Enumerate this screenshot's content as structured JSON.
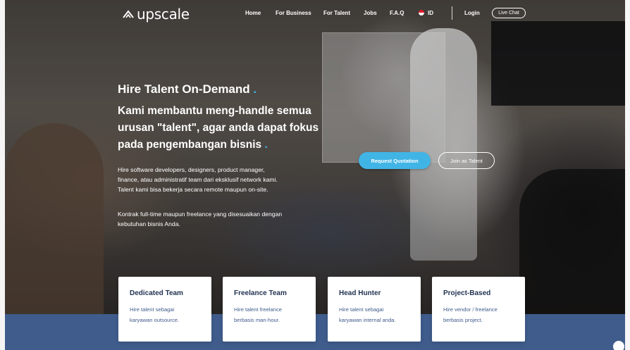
{
  "brand": {
    "name": "upscale"
  },
  "nav": {
    "items": [
      "Home",
      "For Business",
      "For Talent",
      "Jobs",
      "F.A.Q"
    ],
    "language": "ID",
    "login": "Login",
    "live_chat": "Live Chat"
  },
  "hero": {
    "title": "Hire Talent On-Demand",
    "title_dot": ".",
    "subtitle_lines": [
      "Kami membantu meng-handle semua",
      "urusan \"talent\", agar anda dapat fokus",
      "pada pengembangan bisnis"
    ],
    "subtitle_dot": ".",
    "description_lines": [
      "Hire software developers, designers, product manager,",
      "finance, atau administratif team dari eksklusif network kami.",
      "Talent kami bisa bekerja secara remote maupun on-site."
    ],
    "description2_lines": [
      "Kontrak full-time maupun freelance yang disesuaikan dengan",
      "kebutuhan bisnis Anda."
    ],
    "primary_button": "Request Quotation",
    "secondary_button": "Join as Talent"
  },
  "cards": [
    {
      "title": "Dedicated Team",
      "desc": [
        "Hire talent sebagai",
        "karyawan outsource."
      ]
    },
    {
      "title": "Freelance Team",
      "desc": [
        "Hire talent freelance",
        "berbasis man-hour."
      ]
    },
    {
      "title": "Head Hunter",
      "desc": [
        "Hire talent sebagai",
        "karyawan internal anda."
      ]
    },
    {
      "title": "Project-Based",
      "desc": [
        "Hire vendor / freelance",
        "berbasis project."
      ]
    }
  ],
  "colors": {
    "accent": "#41b4e6",
    "band": "#3f5c8c",
    "card_title": "#1f3150"
  },
  "icons": {
    "logo": "upscale-arrow-logo-icon",
    "flag": "indonesia-flag-icon"
  }
}
